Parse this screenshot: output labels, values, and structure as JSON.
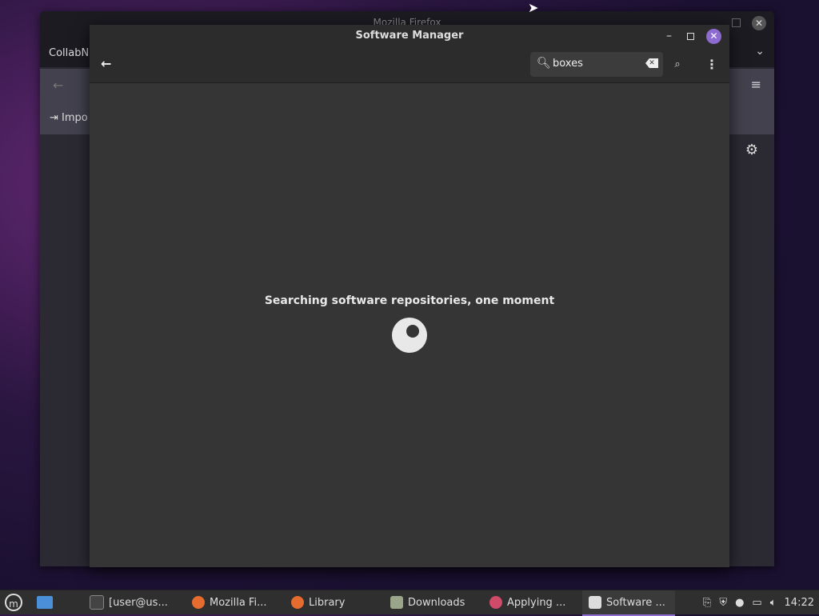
{
  "firefox": {
    "title": "Mozilla Firefox",
    "tab_label": "CollabNe",
    "import_label": "Impo"
  },
  "software_manager": {
    "title": "Software Manager",
    "search": {
      "value": "boxes"
    },
    "status_text": "Searching software repositories, one moment"
  },
  "taskbar": {
    "items": [
      {
        "label": "[user@us..."
      },
      {
        "label": "Mozilla Fi..."
      },
      {
        "label": "Library"
      },
      {
        "label": "Downloads"
      },
      {
        "label": "Applying ..."
      },
      {
        "label": "Software ..."
      }
    ],
    "clock": "14:22"
  }
}
